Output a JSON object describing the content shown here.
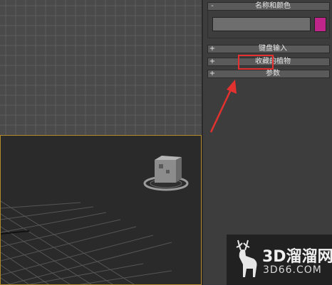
{
  "panel": {
    "rollouts": [
      {
        "sign": "-",
        "label": "名称和颜色"
      },
      {
        "sign": "+",
        "label": "键盘输入"
      },
      {
        "sign": "+",
        "label": "收藏的植物"
      },
      {
        "sign": "+",
        "label": "参数"
      }
    ],
    "name_value": "",
    "swatch_color": "#c0268a",
    "highlight_color": "#e2312f"
  },
  "watermark": {
    "line1": "3D溜溜网",
    "line2": "3D66.COM"
  },
  "icons": [
    "deer-logo-icon",
    "red-arrow-icon",
    "plant-object-icon"
  ]
}
